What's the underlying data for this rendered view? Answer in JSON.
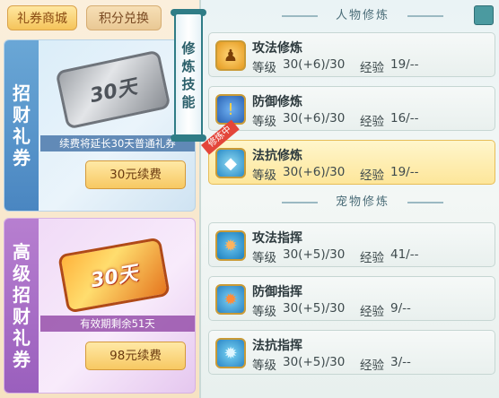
{
  "shop": {
    "tabs": [
      {
        "label": "礼券商城",
        "active": true
      },
      {
        "label": "积分兑换",
        "active": false
      }
    ],
    "cards": [
      {
        "side_title": [
          "招",
          "财",
          "礼",
          "券"
        ],
        "ticket_label": "30天",
        "note": "续费将延长30天普通礼券",
        "button_label": "30元续费"
      },
      {
        "side_title": [
          "高",
          "级",
          "招",
          "财",
          "礼",
          "券"
        ],
        "ticket_label": "30天",
        "note": "有效期剩余51天",
        "button_label": "98元续费"
      }
    ]
  },
  "skills_panel": {
    "vertical_title": [
      "修",
      "炼",
      "技",
      "能"
    ],
    "sections": [
      {
        "title": "人物修炼",
        "items": [
          {
            "name": "攻法修炼",
            "level_label": "等级",
            "level": "30(+6)/30",
            "exp_label": "经验",
            "exp": "19/--",
            "icon": "meditating-figure-icon"
          },
          {
            "name": "防御修炼",
            "level_label": "等级",
            "level": "30(+6)/30",
            "exp_label": "经验",
            "exp": "16/--",
            "icon": "shield-icon"
          },
          {
            "name": "法抗修炼",
            "level_label": "等级",
            "level": "30(+6)/30",
            "exp_label": "经验",
            "exp": "19/--",
            "icon": "magic-resist-icon",
            "selected": true,
            "badge": "修炼中"
          }
        ]
      },
      {
        "title": "宠物修炼",
        "items": [
          {
            "name": "攻法指挥",
            "level_label": "等级",
            "level": "30(+5)/30",
            "exp_label": "经验",
            "exp": "41/--",
            "icon": "paw-attack-icon"
          },
          {
            "name": "防御指挥",
            "level_label": "等级",
            "level": "30(+5)/30",
            "exp_label": "经验",
            "exp": "9/--",
            "icon": "paw-shield-icon"
          },
          {
            "name": "法抗指挥",
            "level_label": "等级",
            "level": "30(+5)/30",
            "exp_label": "经验",
            "exp": "3/--",
            "icon": "paw-magic-icon"
          }
        ]
      }
    ]
  }
}
